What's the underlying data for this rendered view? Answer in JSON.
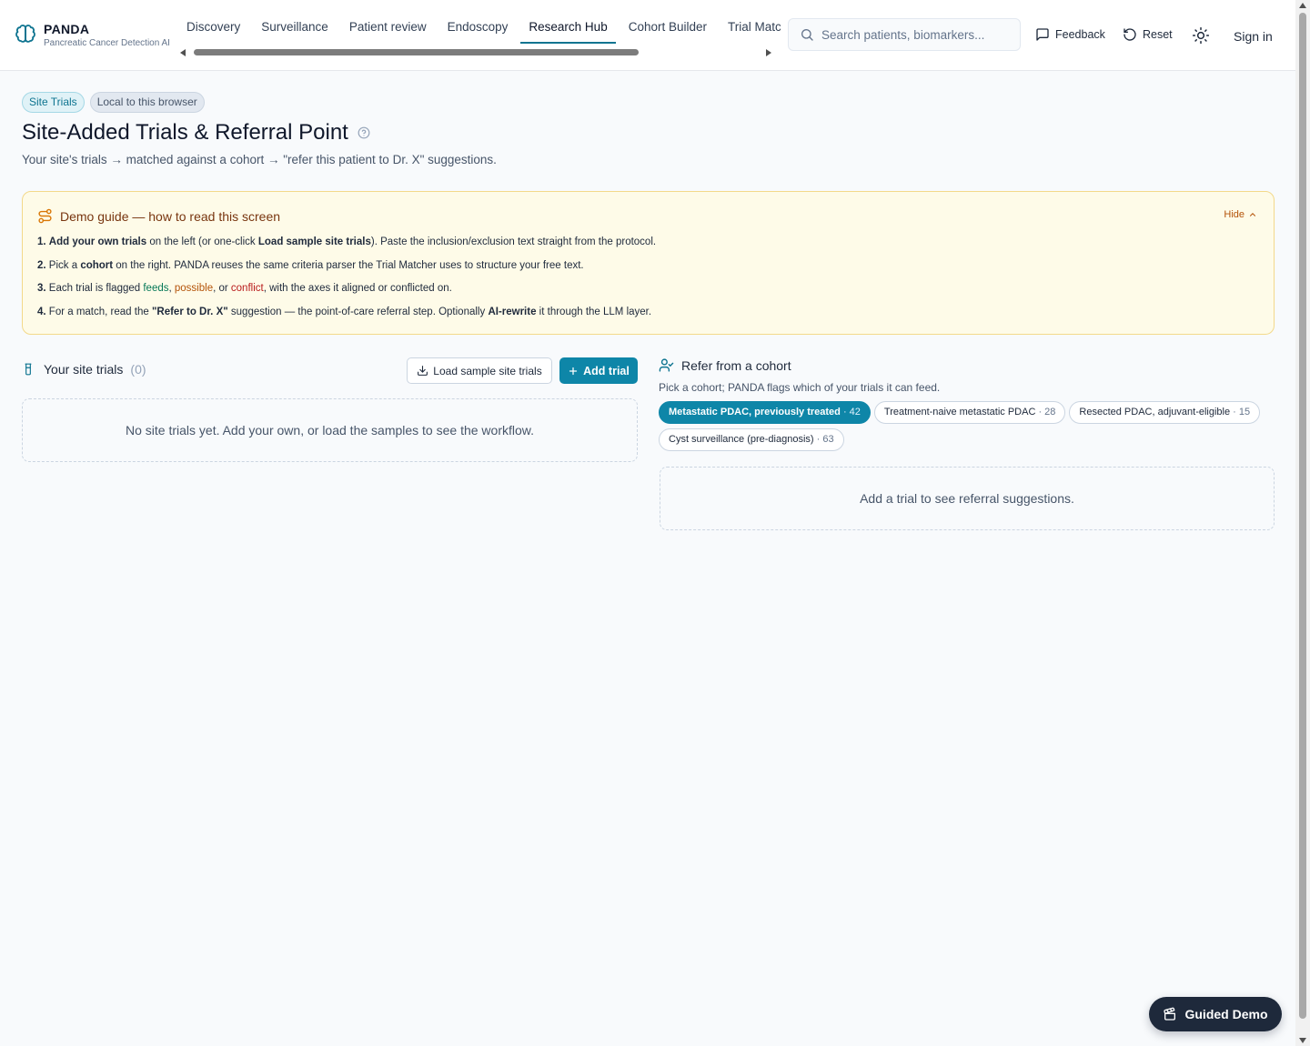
{
  "brand": {
    "name": "PANDA",
    "subtitle": "Pancreatic Cancer Detection AI"
  },
  "nav": {
    "tabs": [
      {
        "label": "Discovery"
      },
      {
        "label": "Surveillance"
      },
      {
        "label": "Patient review"
      },
      {
        "label": "Endoscopy"
      },
      {
        "label": "Research Hub",
        "active": true
      },
      {
        "label": "Cohort Builder"
      },
      {
        "label": "Trial Matcher"
      }
    ]
  },
  "search": {
    "placeholder": "Search patients, biomarkers..."
  },
  "header_actions": {
    "feedback": "Feedback",
    "reset": "Reset",
    "sign_in": "Sign in"
  },
  "badges": {
    "primary": "Site Trials",
    "secondary": "Local to this browser"
  },
  "page": {
    "title": "Site-Added Trials & Referral Point",
    "subtitle": "Your site's trials → matched against a cohort → \"refer this patient to Dr. X\" suggestions."
  },
  "guide": {
    "title": "Demo guide — how to read this screen",
    "hide_label": "Hide",
    "step1": {
      "num": "1.",
      "b1": "Add your own trials",
      "t1": " on the left (or one-click ",
      "b2": "Load sample site trials",
      "t2": "). Paste the inclusion/exclusion text straight from the protocol."
    },
    "step2": {
      "num": "2.",
      "t0": " Pick a ",
      "b1": "cohort",
      "t1": " on the right. PANDA reuses the same criteria parser the Trial Matcher uses to structure your free text."
    },
    "step3": {
      "num": "3.",
      "t0": " Each trial is flagged ",
      "feeds": "feeds",
      "sep1": ", ",
      "possible": "possible",
      "sep2": ", or ",
      "conflict": "conflict",
      "t1": ", with the axes it aligned or conflicted on."
    },
    "step4": {
      "num": "4.",
      "t0": " For a match, read the ",
      "b1": "\"Refer to Dr. X\"",
      "t1": " suggestion — the point-of-care referral step. Optionally ",
      "b2": "AI-rewrite",
      "t2": " it through the LLM layer."
    }
  },
  "site_trials": {
    "title": "Your site trials",
    "count": "(0)",
    "load_samples": "Load sample site trials",
    "add_trial": "Add trial",
    "empty": "No site trials yet. Add your own, or load the samples to see the workflow."
  },
  "refer": {
    "title": "Refer from a cohort",
    "subtitle": "Pick a cohort; PANDA flags which of your trials it can feed.",
    "cohorts": [
      {
        "label": "Metastatic PDAC, previously treated",
        "count": " · 42",
        "active": true
      },
      {
        "label": "Treatment-naive metastatic PDAC",
        "count": " · 28"
      },
      {
        "label": "Resected PDAC, adjuvant-eligible",
        "count": " · 15"
      },
      {
        "label": "Cyst surveillance (pre-diagnosis)",
        "count": " · 63"
      }
    ],
    "empty": "Add a trial to see referral suggestions."
  },
  "guided_demo": "Guided Demo",
  "colors": {
    "accent": "#0e86a8",
    "guide_bg": "#fefbe8",
    "feeds": "#047857",
    "possible": "#b45309",
    "conflict": "#b91c1c"
  }
}
